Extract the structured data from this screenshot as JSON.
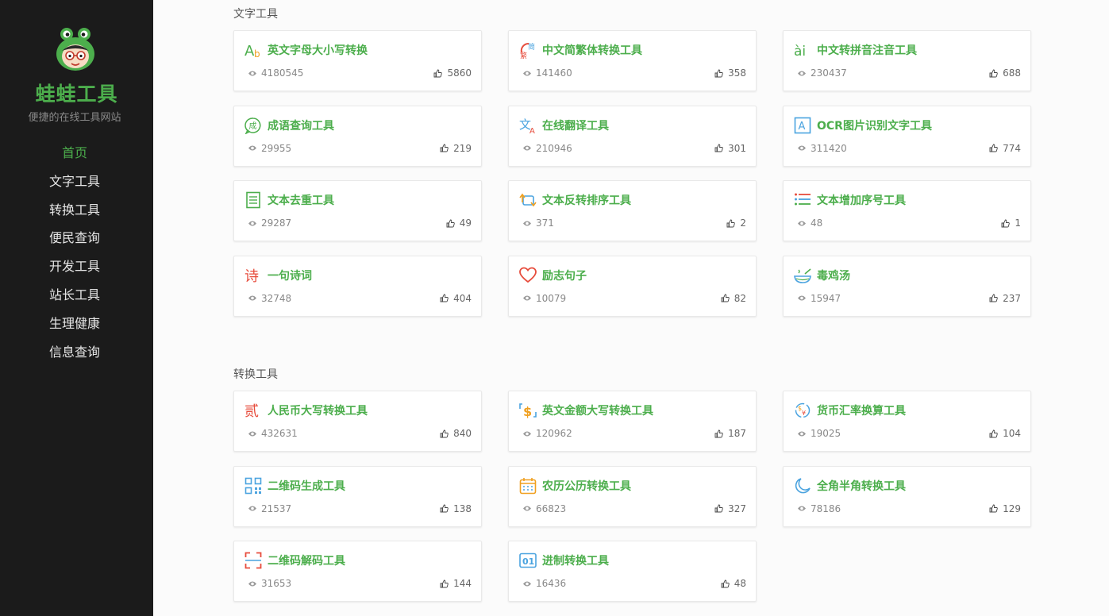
{
  "sidebar": {
    "site_name": "蛙蛙工具",
    "site_slogan": "便捷的在线工具网站",
    "nav": [
      "首页",
      "文字工具",
      "转换工具",
      "便民查询",
      "开发工具",
      "站长工具",
      "生理健康",
      "信息查询"
    ]
  },
  "sections": [
    {
      "title": "文字工具",
      "cards": [
        {
          "name": "英文字母大小写转换",
          "views": "4180545",
          "likes": "5860",
          "icon": "letter-case-icon"
        },
        {
          "name": "中文简繁体转换工具",
          "views": "141460",
          "likes": "358",
          "icon": "simplified-traditional-icon"
        },
        {
          "name": "中文转拼音注音工具",
          "views": "230437",
          "likes": "688",
          "icon": "pinyin-icon"
        },
        {
          "name": "成语查询工具",
          "views": "29955",
          "likes": "219",
          "icon": "idiom-icon"
        },
        {
          "name": "在线翻译工具",
          "views": "210946",
          "likes": "301",
          "icon": "translate-icon"
        },
        {
          "name": "OCR图片识别文字工具",
          "views": "311420",
          "likes": "774",
          "icon": "ocr-icon"
        },
        {
          "name": "文本去重工具",
          "views": "29287",
          "likes": "49",
          "icon": "document-icon"
        },
        {
          "name": "文本反转排序工具",
          "views": "371",
          "likes": "2",
          "icon": "reverse-icon"
        },
        {
          "name": "文本增加序号工具",
          "views": "48",
          "likes": "1",
          "icon": "list-icon"
        },
        {
          "name": "一句诗词",
          "views": "32748",
          "likes": "404",
          "icon": "poem-icon"
        },
        {
          "name": "励志句子",
          "views": "10079",
          "likes": "82",
          "icon": "heart-icon"
        },
        {
          "name": "毒鸡汤",
          "views": "15947",
          "likes": "237",
          "icon": "soup-bowl-icon"
        }
      ]
    },
    {
      "title": "转换工具",
      "cards": [
        {
          "name": "人民币大写转换工具",
          "views": "432631",
          "likes": "840",
          "icon": "rmb-uppercase-icon"
        },
        {
          "name": "英文金额大写转换工具",
          "views": "120962",
          "likes": "187",
          "icon": "dollar-icon"
        },
        {
          "name": "货币汇率换算工具",
          "views": "19025",
          "likes": "104",
          "icon": "currency-exchange-icon"
        },
        {
          "name": "二维码生成工具",
          "views": "21537",
          "likes": "138",
          "icon": "qrcode-icon"
        },
        {
          "name": "农历公历转换工具",
          "views": "66823",
          "likes": "327",
          "icon": "calendar-icon"
        },
        {
          "name": "全角半角转换工具",
          "views": "78186",
          "likes": "129",
          "icon": "moon-icon"
        },
        {
          "name": "二维码解码工具",
          "views": "31653",
          "likes": "144",
          "icon": "scan-icon"
        },
        {
          "name": "进制转换工具",
          "views": "16436",
          "likes": "48",
          "icon": "binary-icon"
        }
      ]
    }
  ],
  "icon_glyphs": {
    "rmb-uppercase": "贰",
    "poem": "诗",
    "idiom": "成",
    "pinyin": "ài",
    "binary": "01",
    "simplified-a": "简",
    "simplified-b": "繁",
    "translate-a": "文",
    "translate-b": "A",
    "ocr": "A",
    "letter-a": "A",
    "letter-b": "b",
    "dollar": "$"
  }
}
